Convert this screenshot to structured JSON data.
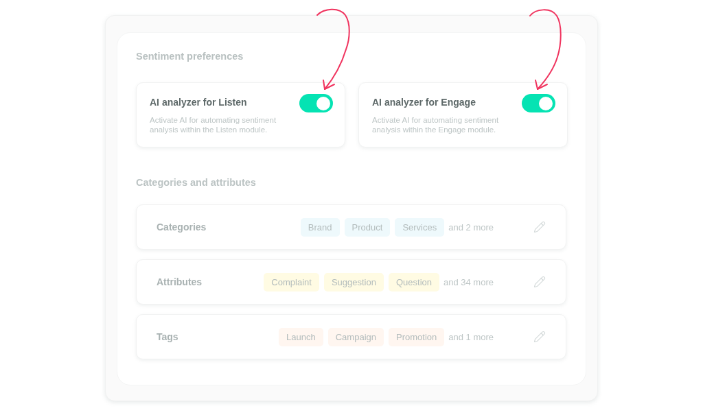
{
  "sentiment_preferences": {
    "title": "Sentiment preferences",
    "cards": [
      {
        "title": "AI analyzer for Listen",
        "description": "Activate AI for automating sentiment analysis within the Listen module.",
        "on": true
      },
      {
        "title": "AI analyzer for Engage",
        "description": "Activate AI for automating sentiment analysis within the Engage module.",
        "on": true
      }
    ]
  },
  "categories_and_attributes": {
    "title": "Categories and attributes",
    "rows": [
      {
        "label": "Categories",
        "color": "#eef9fc",
        "chips": [
          "Brand",
          "Product",
          "Services"
        ],
        "more": "and 2 more"
      },
      {
        "label": "Attributes",
        "color": "#fffbe3",
        "chips": [
          "Complaint",
          "Suggestion",
          "Question"
        ],
        "more": "and 34 more"
      },
      {
        "label": "Tags",
        "color": "#fff6f0",
        "chips": [
          "Launch",
          "Campaign",
          "Promotion"
        ],
        "more": "and 1 more"
      }
    ]
  }
}
